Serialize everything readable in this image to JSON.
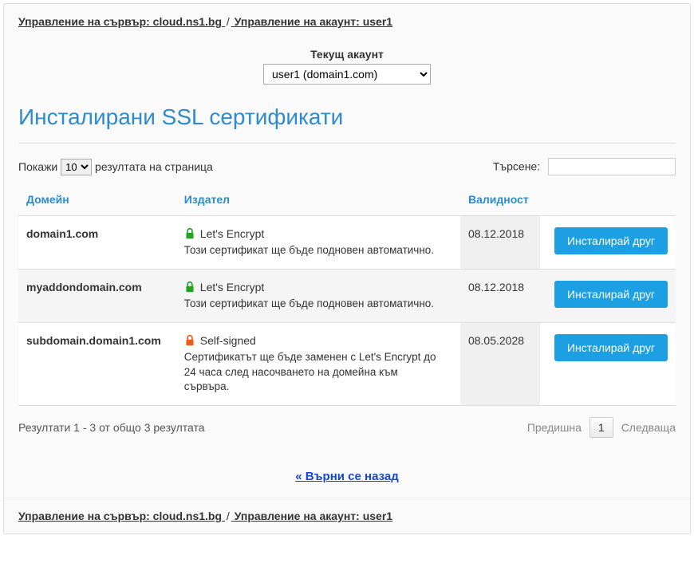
{
  "breadcrumb": {
    "server_label": "Управление на сървър: cloud.ns1.bg",
    "account_label": "Управление на акаунт: user1",
    "separator": "/"
  },
  "account": {
    "label": "Текущ акаунт",
    "selected": "user1 (domain1.com)"
  },
  "page_title": "Инсталирани SSL сертификати",
  "table_controls": {
    "show_prefix": "Покажи",
    "show_suffix": "резултата на страница",
    "page_size": "10",
    "search_label": "Търсене:"
  },
  "columns": {
    "domain": "Домейн",
    "issuer": "Издател",
    "validity": "Валидност",
    "action": ""
  },
  "rows": [
    {
      "domain": "domain1.com",
      "issuer": "Let's Encrypt",
      "lock_color": "#1fa51f",
      "note": "Този сертификат ще бъде подновен автоматично.",
      "validity": "08.12.2018",
      "action": "Инсталирай друг"
    },
    {
      "domain": "myaddondomain.com",
      "issuer": "Let's Encrypt",
      "lock_color": "#1fa51f",
      "note": "Този сертификат ще бъде подновен автоматично.",
      "validity": "08.12.2018",
      "action": "Инсталирай друг"
    },
    {
      "domain": "subdomain.domain1.com",
      "issuer": "Self-signed",
      "lock_color": "#ef5a1a",
      "note": "Сертификатът ще бъде заменен с Let's Encrypt до 24 часа след насочването на домейна към сървъра.",
      "validity": "08.05.2028",
      "action": "Инсталирай друг"
    }
  ],
  "footer": {
    "info": "Резултати 1 - 3 от общо 3 резултата",
    "prev": "Предишна",
    "page": "1",
    "next": "Следваща"
  },
  "back_link": "« Върни се назад"
}
